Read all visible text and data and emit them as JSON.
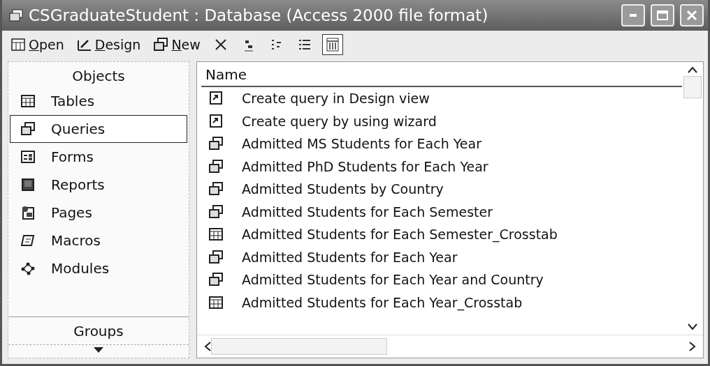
{
  "window": {
    "title": "CSGraduateStudent : Database (Access 2000 file format)"
  },
  "toolbar": {
    "actions": [
      {
        "kind": "open",
        "label": "Open"
      },
      {
        "kind": "design",
        "label": "Design"
      },
      {
        "kind": "new",
        "label": "New"
      },
      {
        "kind": "delete"
      }
    ],
    "views": [
      {
        "kind": "large",
        "selected": false
      },
      {
        "kind": "small",
        "selected": false
      },
      {
        "kind": "list",
        "selected": false
      },
      {
        "kind": "details",
        "selected": true
      }
    ]
  },
  "sidebar": {
    "header": "Objects",
    "items": [
      {
        "kind": "tables",
        "label": "Tables",
        "selected": false
      },
      {
        "kind": "queries",
        "label": "Queries",
        "selected": true
      },
      {
        "kind": "forms",
        "label": "Forms",
        "selected": false
      },
      {
        "kind": "reports",
        "label": "Reports",
        "selected": false
      },
      {
        "kind": "pages",
        "label": "Pages",
        "selected": false
      },
      {
        "kind": "macros",
        "label": "Macros",
        "selected": false
      },
      {
        "kind": "modules",
        "label": "Modules",
        "selected": false
      }
    ],
    "groups": "Groups"
  },
  "list": {
    "columns": [
      "Name"
    ],
    "rows": [
      {
        "kind": "shortcut",
        "name": "Create query in Design view"
      },
      {
        "kind": "shortcut",
        "name": "Create query by using wizard"
      },
      {
        "kind": "query",
        "name": "Admitted MS Students for Each Year"
      },
      {
        "kind": "query",
        "name": "Admitted PhD Students for Each Year"
      },
      {
        "kind": "query",
        "name": "Admitted Students by Country"
      },
      {
        "kind": "query",
        "name": "Admitted Students for Each Semester"
      },
      {
        "kind": "crosstab",
        "name": "Admitted Students for Each Semester_Crosstab"
      },
      {
        "kind": "query",
        "name": "Admitted Students for Each Year"
      },
      {
        "kind": "query",
        "name": "Admitted Students for Each Year and Country"
      },
      {
        "kind": "crosstab",
        "name": "Admitted Students for Each Year_Crosstab"
      }
    ]
  }
}
